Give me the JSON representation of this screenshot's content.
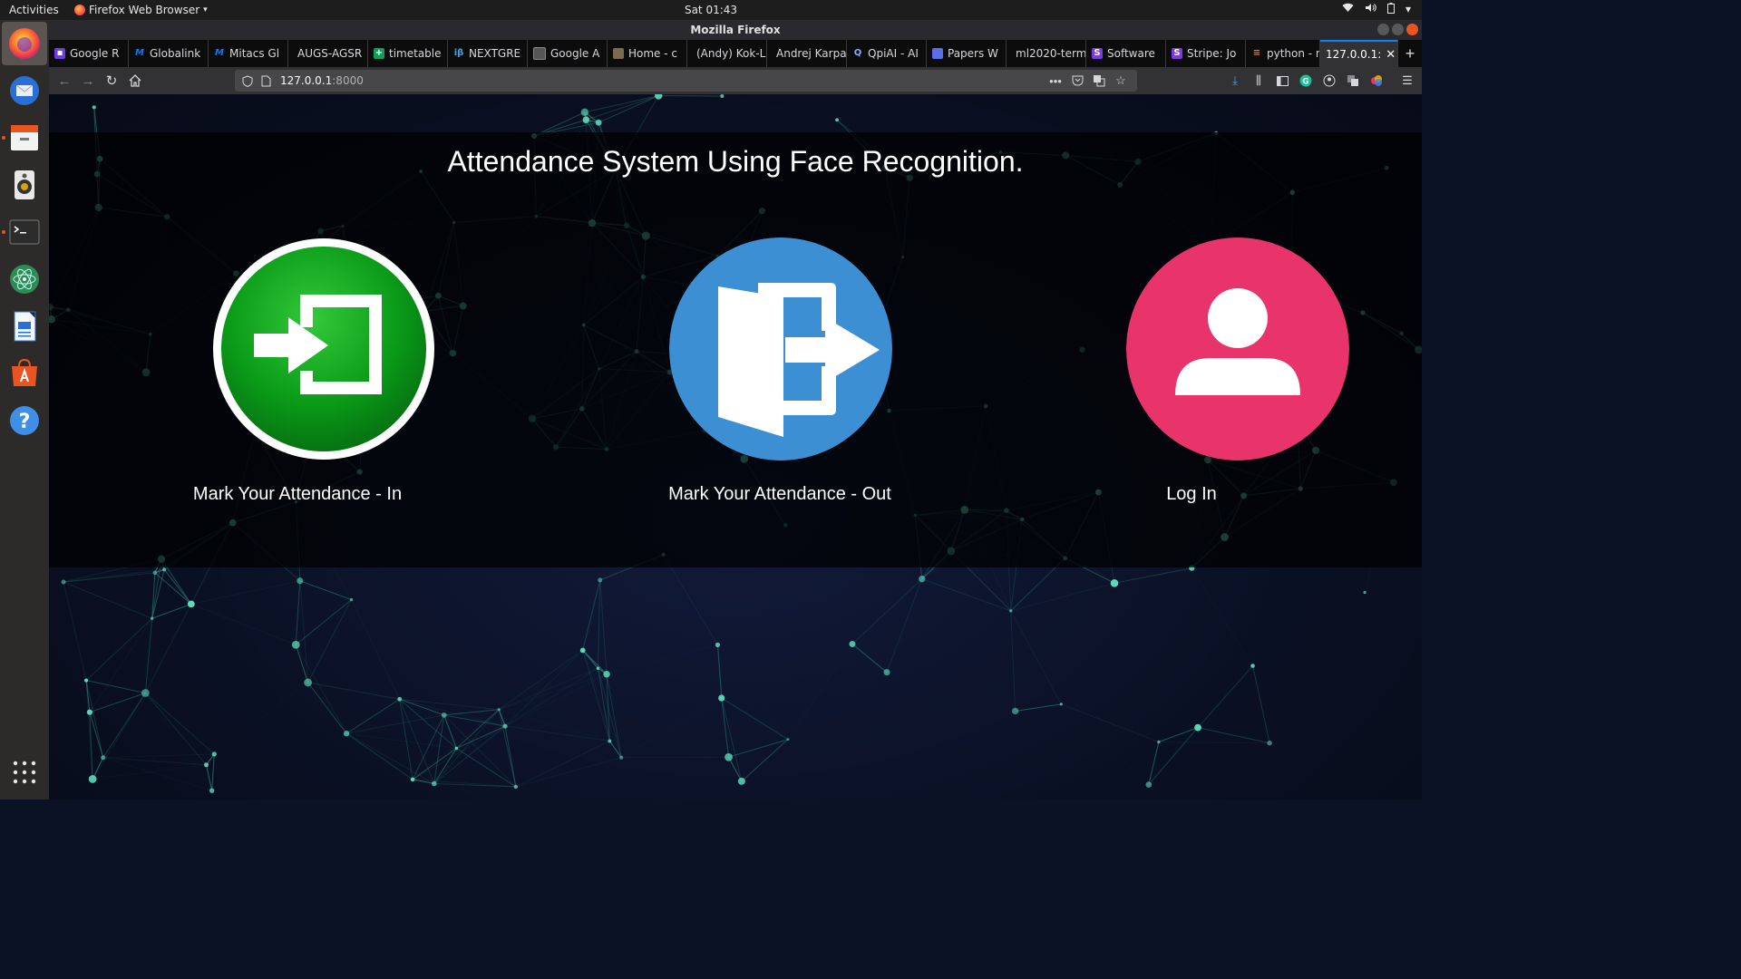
{
  "gnome": {
    "activities": "Activities",
    "app_menu": "Firefox Web Browser",
    "clock": "Sat 01:43"
  },
  "window": {
    "title": "Mozilla Firefox"
  },
  "tabs": [
    {
      "label": "Google R",
      "icon": "google-icon",
      "color": "#6a3de8"
    },
    {
      "label": "Globalink",
      "icon": "mitacs-icon",
      "color": "#1a73e8"
    },
    {
      "label": "Mitacs Gl",
      "icon": "mitacs-icon",
      "color": "#1a73e8"
    },
    {
      "label": "AUGS-AGSR",
      "icon": "",
      "color": ""
    },
    {
      "label": "timetable",
      "icon": "sheets-icon",
      "color": "#0f9d58"
    },
    {
      "label": "NEXTGRE",
      "icon": "ib-icon",
      "color": "#4aa3df"
    },
    {
      "label": "Google A",
      "icon": "image-icon",
      "color": "#888888"
    },
    {
      "label": "Home - c",
      "icon": "home-icon",
      "color": "#7a6a4f"
    },
    {
      "label": "(Andy) Kok-L",
      "icon": "",
      "color": ""
    },
    {
      "label": "Andrej Karpa",
      "icon": "",
      "color": ""
    },
    {
      "label": "QpiAI - AI",
      "icon": "search-icon",
      "color": "#7fb0ff"
    },
    {
      "label": "Papers W",
      "icon": "papers-icon",
      "color": "#5a6ee6"
    },
    {
      "label": "ml2020-term",
      "icon": "",
      "color": ""
    },
    {
      "label": "Software",
      "icon": "s-icon",
      "color": "#7b3ae6"
    },
    {
      "label": "Stripe: Jo",
      "icon": "s-icon",
      "color": "#7b3ae6"
    },
    {
      "label": "python - r",
      "icon": "stackoverflow-icon",
      "color": "#f48024"
    },
    {
      "label": "127.0.0.1:",
      "icon": "",
      "color": "",
      "active": true
    }
  ],
  "nav": {
    "url_host": "127.0.0.1",
    "url_port": ":8000"
  },
  "page": {
    "heading": "Attendance System Using Face Recognition.",
    "cards": [
      {
        "label": "Mark Your Attendance - In",
        "icon": "sign-in-icon",
        "color": "#0c9a1c"
      },
      {
        "label": "Mark Your Attendance - Out",
        "icon": "sign-out-icon",
        "color": "#3d8fd4"
      },
      {
        "label": "Log In",
        "icon": "user-icon",
        "color": "#e8336b"
      }
    ]
  }
}
